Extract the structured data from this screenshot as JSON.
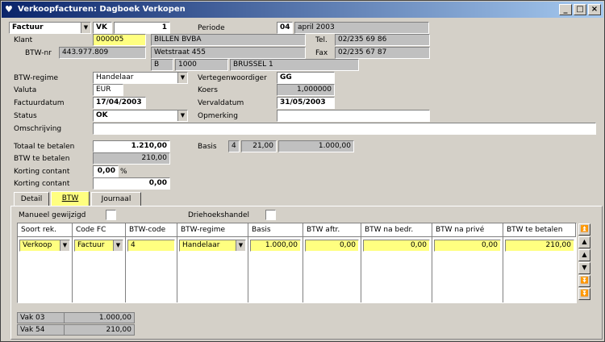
{
  "window": {
    "title": "Verkoopfacturen: Dagboek Verkopen",
    "buttons": {
      "minimize": "_",
      "maximize": "□",
      "close": "×"
    }
  },
  "header": {
    "doc_type": "Factuur",
    "journal": "VK",
    "number": "1",
    "periode_label": "Periode",
    "periode_nr": "04",
    "periode_text": "april 2003"
  },
  "klant": {
    "label": "Klant",
    "code": "000005",
    "name": "BILLEN BVBA",
    "tel_label": "Tel.",
    "tel": "02/235 69 86",
    "btwnr_label": "BTW-nr",
    "btwnr": "443.977.809",
    "street": "Wetstraat 455",
    "fax_label": "Fax",
    "fax": "02/235 67 87",
    "country": "B",
    "zip": "1000",
    "city": "BRUSSEL 1"
  },
  "details": {
    "btw_regime_label": "BTW-regime",
    "btw_regime": "Handelaar",
    "vertegenwoordiger_label": "Vertegenwoordiger",
    "vertegenwoordiger": "GG",
    "valuta_label": "Valuta",
    "valuta": "EUR",
    "koers_label": "Koers",
    "koers": "1,000000",
    "factuurdatum_label": "Factuurdatum",
    "factuurdatum": "17/04/2003",
    "vervaldatum_label": "Vervaldatum",
    "vervaldatum": "31/05/2003",
    "status_label": "Status",
    "status": "OK",
    "opmerking_label": "Opmerking",
    "opmerking": "",
    "omschrijving_label": "Omschrijving",
    "omschrijving": ""
  },
  "totals": {
    "totaal_label": "Totaal te betalen",
    "totaal": "1.210,00",
    "btw_label": "BTW te betalen",
    "btw": "210,00",
    "korting_label": "Korting contant",
    "korting_pct": "0,00",
    "pct_sign": "%",
    "korting2_label": "Korting contant",
    "korting_amount": "0,00",
    "basis_label": "Basis",
    "basis_code": "4",
    "basis_rate": "21,00",
    "basis_amount": "1.000,00"
  },
  "tabs": [
    {
      "label": "Detail"
    },
    {
      "label": "BTW"
    },
    {
      "label": "Journaal"
    }
  ],
  "btw_tab": {
    "manueel_label": "Manueel gewijzigd",
    "driehoek_label": "Driehoekshandel",
    "columns": [
      "Soort rek.",
      "Code FC",
      "BTW-code",
      "BTW-regime",
      "Basis",
      "BTW aftr.",
      "BTW na bedr.",
      "BTW na privé",
      "BTW te betalen"
    ],
    "row": {
      "soort": "Verkoop",
      "code_fc": "Factuur",
      "btw_code": "4",
      "btw_regime": "Handelaar",
      "basis": "1.000,00",
      "btw_aftr": "0,00",
      "btw_na_bedr": "0,00",
      "btw_na_prive": "0,00",
      "btw_te_betalen": "210,00"
    },
    "vakken": [
      {
        "label": "Vak 03",
        "value": "1.000,00"
      },
      {
        "label": "Vak 54",
        "value": "210,00"
      }
    ]
  },
  "colors": {
    "title_start": "#0a246a",
    "title_end": "#a6caf0",
    "highlight": "#ffff80",
    "face": "#d4d0c8"
  }
}
